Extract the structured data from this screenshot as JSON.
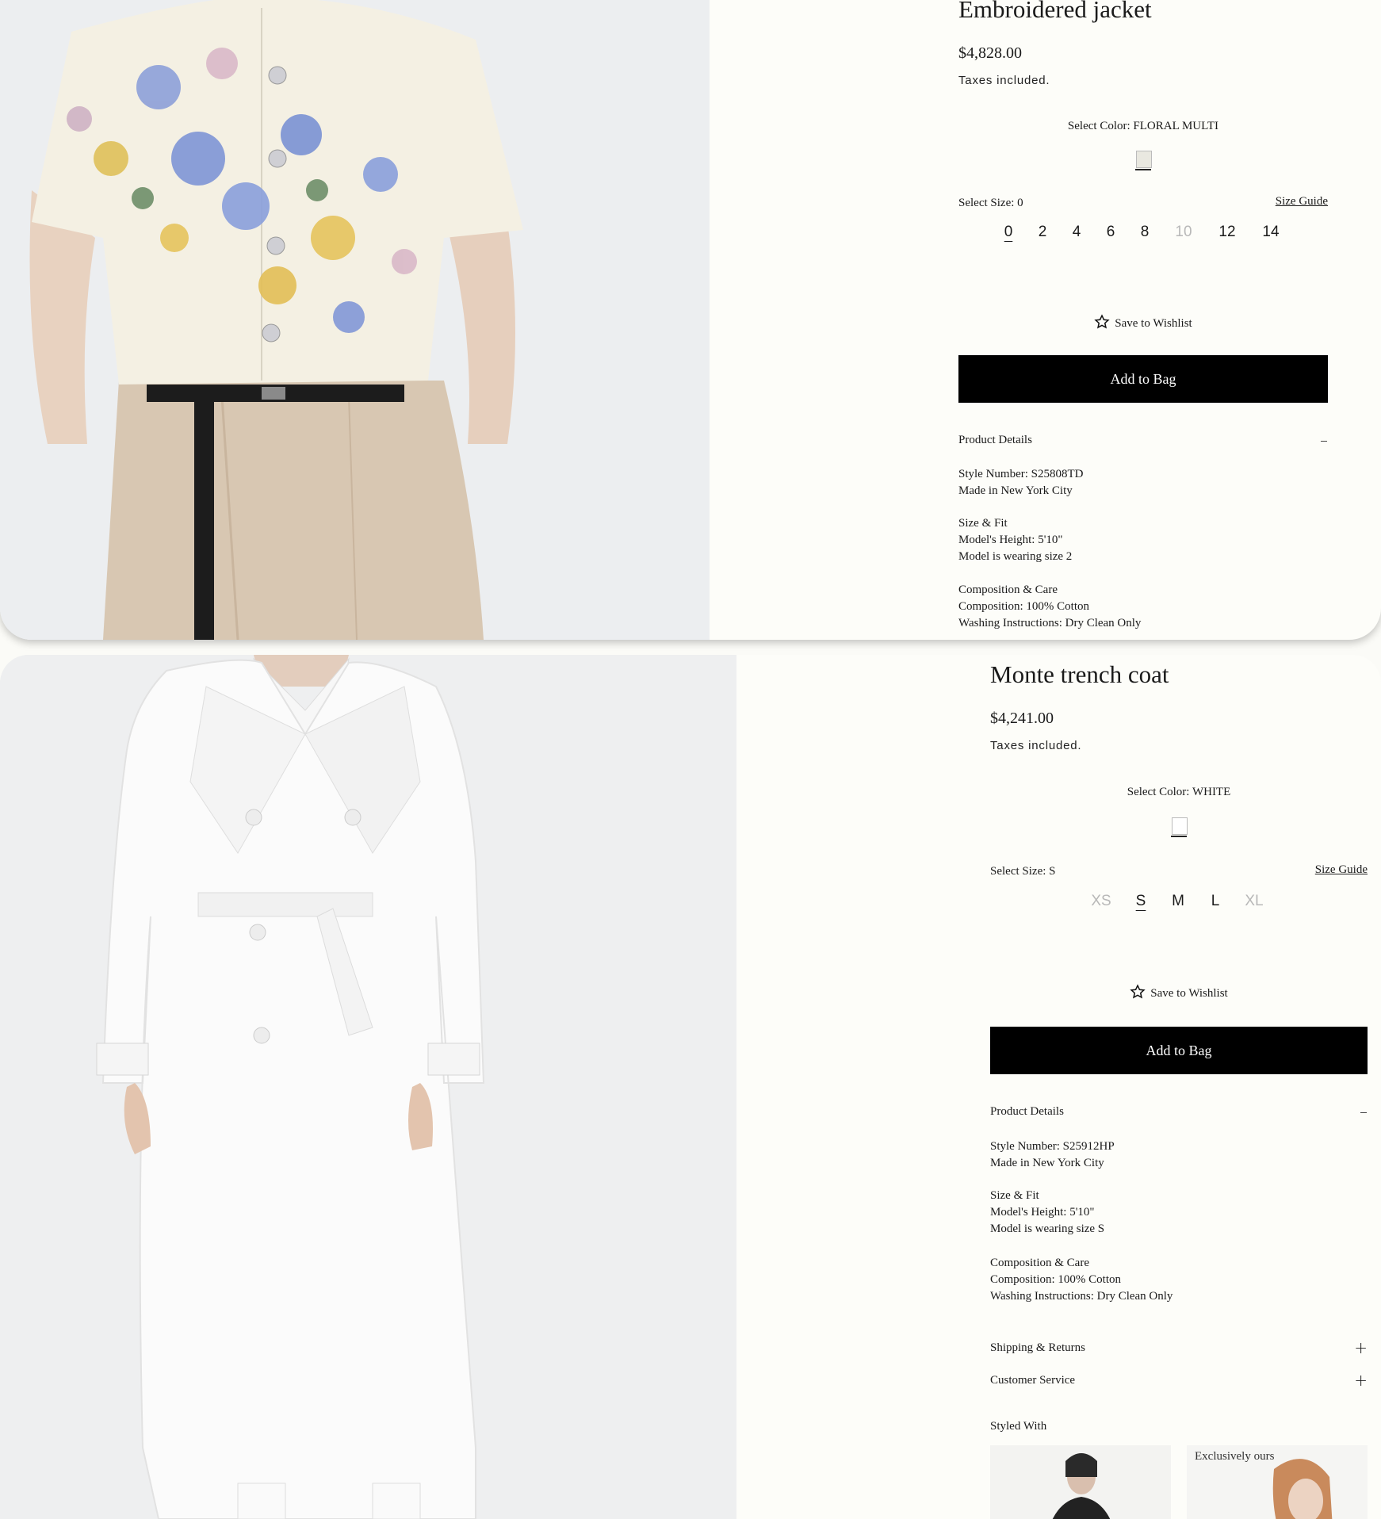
{
  "products": [
    {
      "title": "Embroidered jacket",
      "price": "$4,828.00",
      "tax_note": "Taxes included.",
      "color_label": "Select Color: FLORAL MULTI",
      "size_label": "Select Size: 0",
      "size_guide": "Size Guide",
      "sizes": [
        "0",
        "2",
        "4",
        "6",
        "8",
        "10",
        "12",
        "14"
      ],
      "selected_size": "0",
      "unavailable_sizes": [
        "10"
      ],
      "wishlist": "Save to Wishlist",
      "add_to_bag": "Add to Bag",
      "details_heading": "Product Details",
      "style_number": "Style Number: S25808TD",
      "made_in": "Made in New York City",
      "size_fit_heading": "Size & Fit",
      "model_height": "Model's Height: 5'10\"",
      "model_size": "Model is wearing size 2",
      "composition_heading": "Composition & Care",
      "composition": "Composition:  100% Cotton",
      "washing": "Washing Instructions: Dry Clean Only"
    },
    {
      "title": "Monte trench coat",
      "price": "$4,241.00",
      "tax_note": "Taxes included.",
      "color_label": "Select Color: WHITE",
      "size_label": "Select Size: S",
      "size_guide": "Size Guide",
      "sizes": [
        "XS",
        "S",
        "M",
        "L",
        "XL"
      ],
      "selected_size": "S",
      "unavailable_sizes": [
        "XS",
        "XL"
      ],
      "wishlist": "Save to Wishlist",
      "add_to_bag": "Add to Bag",
      "details_heading": "Product Details",
      "style_number": "Style Number: S25912HP",
      "made_in": "Made in New York City",
      "size_fit_heading": "Size & Fit",
      "model_height": "Model's Height: 5'10\"",
      "model_size": "Model is wearing size S",
      "composition_heading": "Composition & Care",
      "composition": "Composition: 100% Cotton",
      "washing": "Washing Instructions: Dry Clean Only",
      "shipping": "Shipping & Returns",
      "customer_service": "Customer Service",
      "styled_with": "Styled With",
      "styled_thumb_2_text": "Exclusively ours"
    }
  ],
  "icons": {
    "wishlist": "star-outline-icon",
    "collapse": "minus-icon",
    "expand": "plus-icon"
  },
  "colors": {
    "accent": "#000000",
    "swatch_floral": "#e9e8e0",
    "swatch_white": "#ffffff"
  }
}
